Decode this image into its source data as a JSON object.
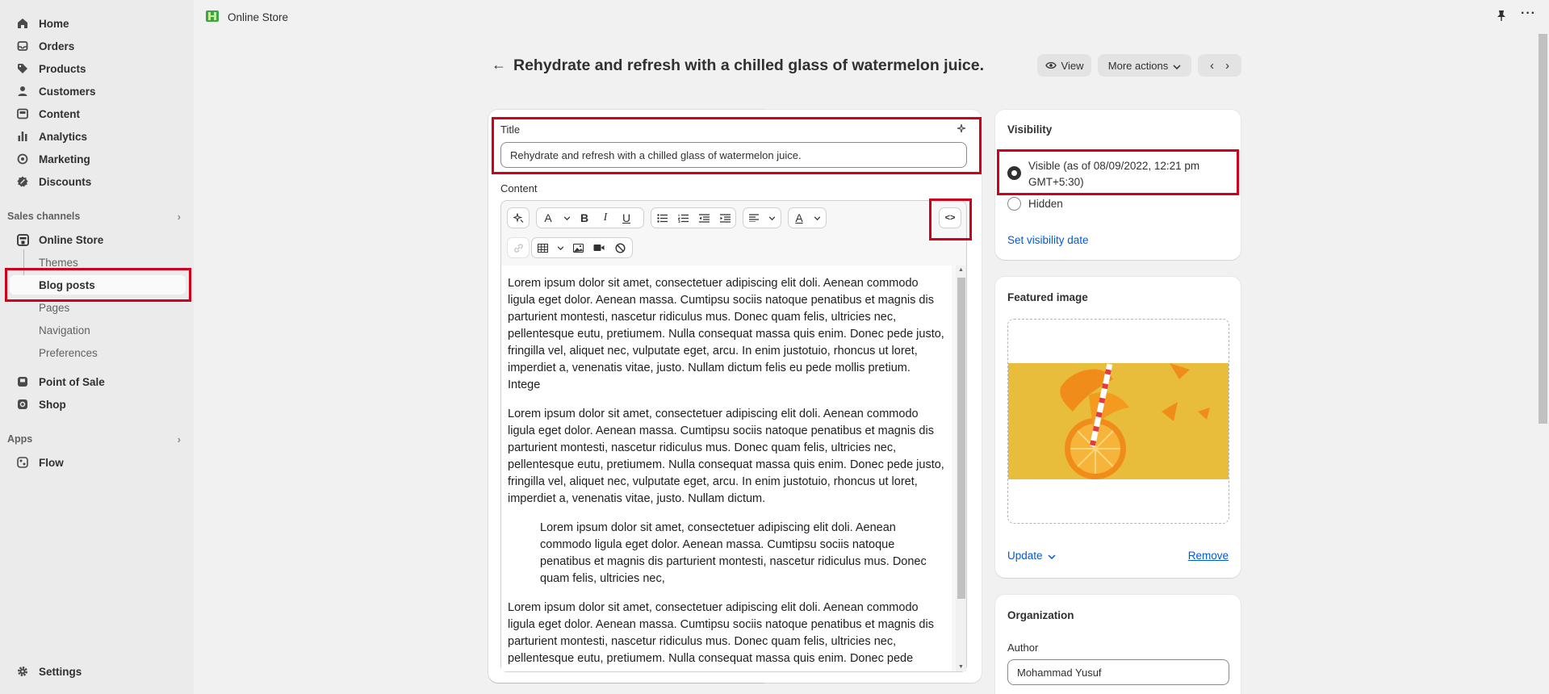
{
  "sidebar": {
    "items": [
      {
        "label": "Home",
        "icon": "home-icon"
      },
      {
        "label": "Orders",
        "icon": "inbox-icon"
      },
      {
        "label": "Products",
        "icon": "tag-icon"
      },
      {
        "label": "Customers",
        "icon": "person-icon"
      },
      {
        "label": "Content",
        "icon": "content-icon"
      },
      {
        "label": "Analytics",
        "icon": "bar-chart-icon"
      },
      {
        "label": "Marketing",
        "icon": "target-icon"
      },
      {
        "label": "Discounts",
        "icon": "discount-icon"
      }
    ],
    "sales_channels_label": "Sales channels",
    "online_store_label": "Online Store",
    "sub_items": [
      "Themes",
      "Blog posts",
      "Pages",
      "Navigation",
      "Preferences"
    ],
    "point_of_sale_label": "Point of Sale",
    "shop_label": "Shop",
    "apps_label": "Apps",
    "flow_label": "Flow",
    "settings_label": "Settings"
  },
  "topbar": {
    "title": "Online Store"
  },
  "header": {
    "title": "Rehydrate and refresh with a chilled glass of watermelon juice.",
    "view_label": "View",
    "more_actions_label": "More actions"
  },
  "editor": {
    "title_label": "Title",
    "title_value": "Rehydrate and refresh with a chilled  glass of watermelon juice.",
    "content_label": "Content",
    "paragraphs": [
      "Lorem ipsum dolor sit amet, consectetuer adipiscing elit doli. Aenean commodo ligula eget dolor. Aenean massa. Cumtipsu sociis natoque penatibus et magnis dis parturient montesti, nascetur ridiculus mus. Donec quam felis, ultricies nec, pellentesque eutu, pretiumem. Nulla consequat massa quis enim. Donec pede justo, fringilla vel, aliquet nec, vulputate eget, arcu. In enim justotuio, rhoncus ut loret, imperdiet a, venenatis vitae, justo. Nullam dictum felis eu pede mollis pretium. Intege",
      "Lorem ipsum dolor sit amet, consectetuer adipiscing elit doli. Aenean commodo ligula eget dolor. Aenean massa. Cumtipsu sociis natoque penatibus et magnis dis parturient montesti, nascetur ridiculus mus. Donec quam felis, ultricies nec, pellentesque eutu, pretiumem. Nulla consequat massa quis enim. Donec pede justo, fringilla vel, aliquet nec, vulputate eget, arcu. In enim justotuio, rhoncus ut loret, imperdiet a, venenatis vitae, justo. Nullam dictum.",
      "Lorem ipsum dolor sit amet, consectetuer adipiscing elit doli. Aenean commodo ligula eget dolor. Aenean massa. Cumtipsu sociis natoque penatibus et magnis dis parturient montesti, nascetur ridiculus mus. Donec quam felis, ultricies nec,",
      "Lorem ipsum dolor sit amet, consectetuer adipiscing elit doli. Aenean commodo ligula eget dolor. Aenean massa. Cumtipsu sociis natoque penatibus et magnis dis parturient montesti, nascetur ridiculus mus. Donec quam felis, ultricies nec, pellentesque eutu, pretiumem. Nulla consequat massa quis enim. Donec pede"
    ],
    "html_toggle_label": "<>"
  },
  "visibility": {
    "heading": "Visibility",
    "visible_label": "Visible (as of 08/09/2022, 12:21 pm",
    "visible_label_2": "GMT+5:30)",
    "hidden_label": "Hidden",
    "set_date_label": "Set visibility date"
  },
  "featured_image": {
    "heading": "Featured image",
    "update_label": "Update",
    "remove_label": "Remove"
  },
  "organization": {
    "heading": "Organization",
    "author_label": "Author",
    "author_value": "Mohammad Yusuf"
  },
  "colors": {
    "accent": "#005bd3",
    "highlight": "#d0021b",
    "image_bg": "#e9c03f"
  }
}
